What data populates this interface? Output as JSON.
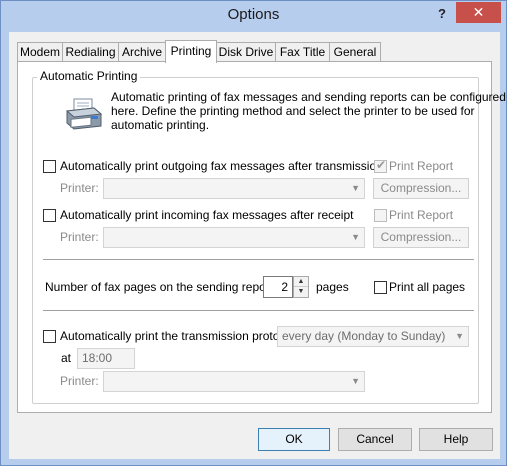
{
  "window": {
    "title": "Options",
    "help_glyph": "?",
    "close_glyph": "✕"
  },
  "tabs": [
    {
      "label": "Modem"
    },
    {
      "label": "Redialing"
    },
    {
      "label": "Archive"
    },
    {
      "label": "Printing"
    },
    {
      "label": "Disk Drive"
    },
    {
      "label": "Fax Title"
    },
    {
      "label": "General"
    }
  ],
  "group": {
    "label": "Automatic Printing",
    "description_lines": [
      "Automatic printing of fax messages and sending reports can be configured",
      "here. Define the printing method and select the printer to be used for",
      "automatic printing."
    ]
  },
  "outgoing": {
    "checkbox_label": "Automatically print outgoing fax messages after transmission",
    "checked": false,
    "printer_label": "Printer:",
    "printer_value": "",
    "print_report_label": "Print Report",
    "print_report_checked": true,
    "compression_label": "Compression..."
  },
  "incoming": {
    "checkbox_label": "Automatically print incoming fax messages after receipt",
    "checked": false,
    "printer_label": "Printer:",
    "printer_value": "",
    "print_report_label": "Print Report",
    "print_report_checked": false,
    "compression_label": "Compression..."
  },
  "report_pages": {
    "label": "Number of fax pages on the sending report:",
    "value": "2",
    "suffix": "pages",
    "print_all_label": "Print all pages",
    "print_all_checked": false
  },
  "protocol": {
    "checkbox_label": "Automatically print the transmission protocol",
    "checked": false,
    "schedule_value": "every day (Monday to Sunday)",
    "at_label": "at",
    "time_value": "18:00",
    "printer_label": "Printer:",
    "printer_value": ""
  },
  "footer": {
    "ok_label": "OK",
    "cancel_label": "Cancel",
    "help_label": "Help"
  },
  "colors": {
    "titlebar": "#b6cdee",
    "close": "#c7504a",
    "panel": "#ffffff",
    "default_button_border": "#3c7fb1"
  }
}
